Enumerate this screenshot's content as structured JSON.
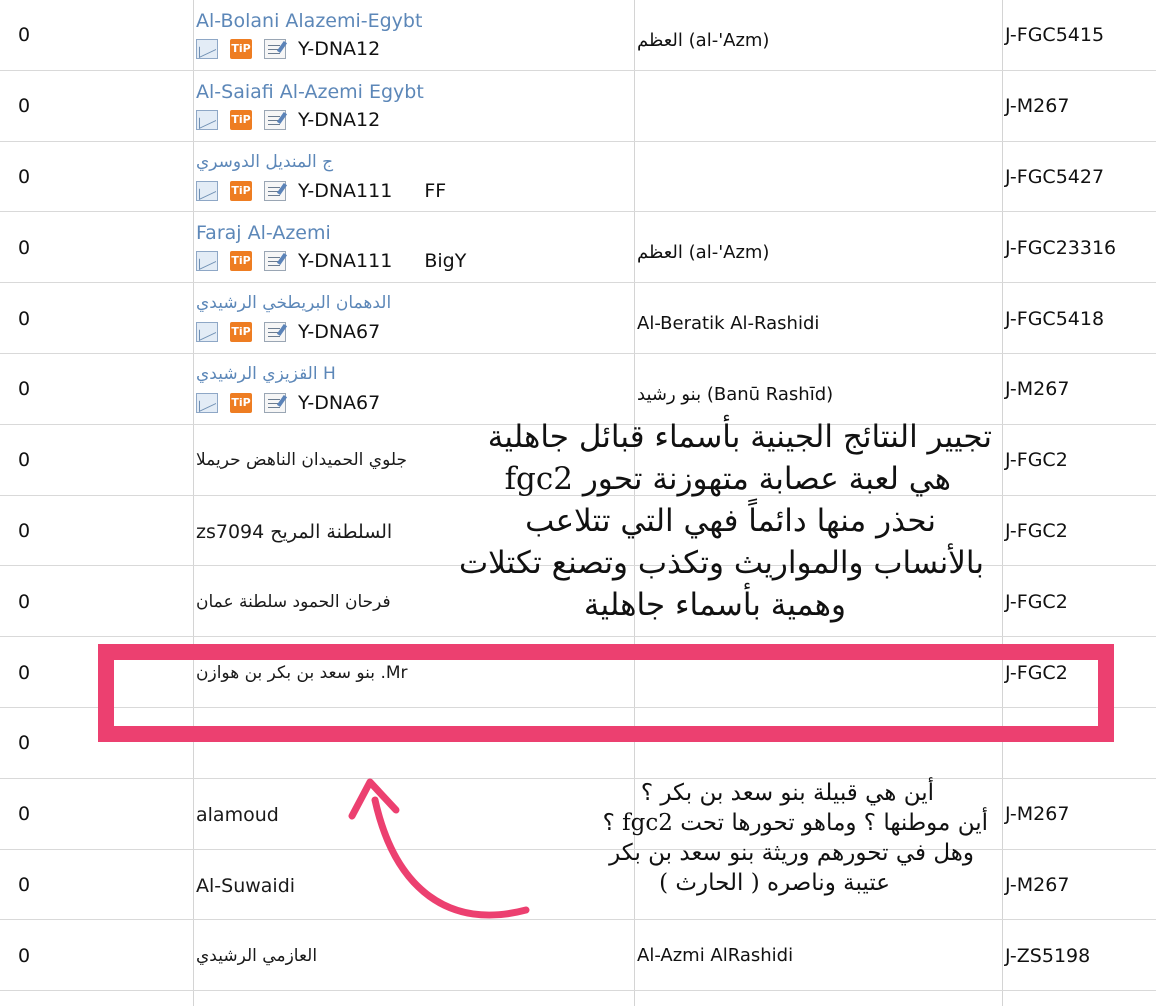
{
  "rows": [
    {
      "score": "0",
      "name": "Al-Bolani Alazemi-Egybt",
      "name_style": "link",
      "kit": "Y-DNA12",
      "extra": "",
      "ancestral": "العظم (al-'Azm)",
      "haplogroup": "J-FGC5415",
      "tools": true
    },
    {
      "score": "0",
      "name": "Al-Saiafi Al-Azemi Egybt",
      "name_style": "link",
      "kit": "Y-DNA12",
      "extra": "",
      "ancestral": "",
      "haplogroup": "J-M267",
      "tools": true
    },
    {
      "score": "0",
      "name": "ج المنديل الدوسري",
      "name_style": "link",
      "kit": "Y-DNA111",
      "extra": "FF",
      "ancestral": "",
      "haplogroup": "J-FGC5427",
      "tools": true
    },
    {
      "score": "0",
      "name": "Faraj Al-Azemi",
      "name_style": "link",
      "kit": "Y-DNA111",
      "extra": "BigY",
      "ancestral": "العظم (al-'Azm)",
      "haplogroup": "J-FGC23316",
      "tools": true
    },
    {
      "score": "0",
      "name": "الدهمان البريطخي الرشيدي",
      "name_style": "link",
      "kit": "Y-DNA67",
      "extra": "",
      "ancestral": "Al-Beratik Al-Rashidi",
      "haplogroup": "J-FGC5418",
      "tools": true
    },
    {
      "score": "0",
      "name": "القزيزي الرشيدي H",
      "name_style": "link",
      "kit": "Y-DNA67",
      "extra": "",
      "ancestral": "بنو رشيد (Banū Rashīd)",
      "haplogroup": "J-M267",
      "tools": true
    },
    {
      "score": "0",
      "name": "جلوي الحميدان الناهض حريملا",
      "name_style": "plain",
      "kit": "",
      "extra": "",
      "ancestral": "",
      "haplogroup": "J-FGC2",
      "tools": false
    },
    {
      "score": "0",
      "name": "zs7094 السلطنة المريح",
      "name_style": "plain",
      "kit": "",
      "extra": "",
      "ancestral": "",
      "haplogroup": "J-FGC2",
      "tools": false
    },
    {
      "score": "0",
      "name": "فرحان الحمود سلطنة عمان",
      "name_style": "plain",
      "kit": "",
      "extra": "",
      "ancestral": "",
      "haplogroup": "J-FGC2",
      "tools": false
    },
    {
      "score": "0",
      "name": "بنو سعد بن بكر بن هوازن .Mr",
      "name_style": "plain",
      "kit": "",
      "extra": "",
      "ancestral": "",
      "haplogroup": "J-FGC2",
      "tools": false
    },
    {
      "score": "0",
      "name": "",
      "name_style": "plain",
      "kit": "",
      "extra": "",
      "ancestral": "",
      "haplogroup": "",
      "tools": false
    },
    {
      "score": "0",
      "name": "alamoud",
      "name_style": "plain",
      "kit": "",
      "extra": "",
      "ancestral": "",
      "haplogroup": "J-M267",
      "tools": false
    },
    {
      "score": "0",
      "name": "Al-Suwaidi",
      "name_style": "plain",
      "kit": "",
      "extra": "",
      "ancestral": "",
      "haplogroup": "J-M267",
      "tools": false
    },
    {
      "score": "0",
      "name": "العازمي الرشيدي",
      "name_style": "plain",
      "kit": "",
      "extra": "",
      "ancestral": "Al-Azmi AlRashidi",
      "haplogroup": "J-ZS5198",
      "tools": false
    }
  ],
  "icons": {
    "mail": "mail-icon",
    "tip": "tip-icon",
    "note": "note-icon",
    "tip_label": "TiP"
  },
  "annotation_main": [
    "تجيير النتائج الجينية بأسماء قبائل جاهلية",
    "هي لعبة عصابة متهوزنة تحور fgc2",
    "نحذر منها دائماً فهي التي تتلاعب",
    "بالأنساب والمواريث وتكذب وتصنع تكتلات",
    "وهمية بأسماء جاهلية"
  ],
  "annotation_question": [
    "أين  هي قبيلة بنو سعد بن بكر ؟",
    "أين موطنها  ؟ وماهو تحورها تحت fgc2 ؟",
    "وهل في تحورهم  وريثة بنو سعد بن بكر",
    "عتيبة وناصره ( الحارث )"
  ],
  "colors": {
    "highlight": "#ec4070",
    "link": "#5c87b8",
    "tip": "#ee7d22"
  }
}
